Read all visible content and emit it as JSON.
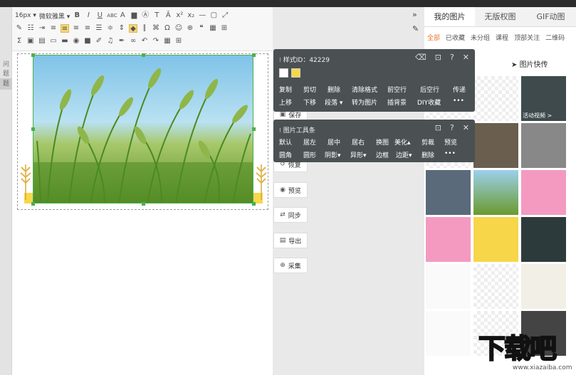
{
  "editor": {
    "font_size": "16px",
    "font_family": "微软雅黑"
  },
  "left_tabs": [
    "问题",
    "题"
  ],
  "popup_style": {
    "title_prefix": "样式ID：",
    "style_id": "42229",
    "swatches": [
      "#ffffff",
      "#f6d84a"
    ],
    "row1": [
      "复制",
      "剪切",
      "删除",
      "清除格式",
      "前空行",
      "后空行",
      "传递"
    ],
    "row2": [
      "上移",
      "下移",
      "段落",
      "转为图片",
      "插背景",
      "DIY收藏",
      "•••"
    ]
  },
  "popup_image": {
    "title": "图片工具条",
    "row1": [
      "默认",
      "居左",
      "居中",
      "居右",
      "换图",
      "美化",
      "剪裁",
      "预览"
    ],
    "row2": [
      "圆角",
      "圆形",
      "阴影",
      "异形",
      "边框",
      "边距",
      "删除",
      "•••"
    ]
  },
  "side_buttons": [
    {
      "label": "保存",
      "icon": "save-icon"
    },
    {
      "label": "恢复",
      "icon": "restore-icon"
    },
    {
      "label": "预览",
      "icon": "eye-icon"
    },
    {
      "label": "同步",
      "icon": "sync-icon"
    },
    {
      "label": "导出",
      "icon": "export-icon"
    },
    {
      "label": "采集",
      "icon": "collect-icon"
    }
  ],
  "right_panel": {
    "tabs": [
      "我的图片",
      "无版权图",
      "GIF动图"
    ],
    "filters": [
      "全部",
      "已收藏",
      "未分组",
      "课程",
      "顶部关注",
      "二维码"
    ],
    "actions": [
      "传",
      "图片快传"
    ],
    "active_caption": "活动视频 >"
  },
  "watermark": {
    "big": "下载吧",
    "small": "www.xiazaiba.com"
  }
}
